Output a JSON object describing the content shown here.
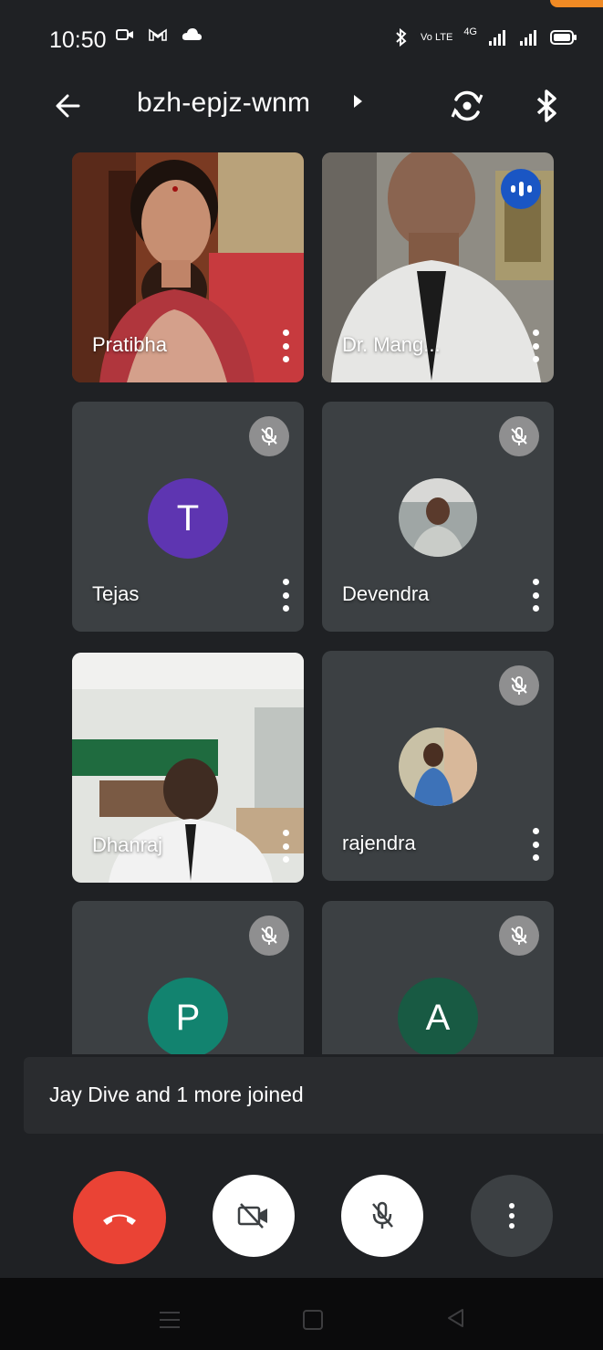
{
  "status_bar": {
    "time": "10:50",
    "left_icons": [
      "screen-record-icon",
      "gmail-icon",
      "cloud-icon"
    ],
    "right_icons": [
      "bluetooth-icon",
      "volte-icon",
      "4g-signal-icon",
      "signal-icon",
      "battery-icon"
    ],
    "volte_label": "Vo LTE",
    "network_label": "4G"
  },
  "header": {
    "back_icon": "arrow-back-icon",
    "meeting_code": "bzh-epjz-wnm",
    "switch_camera_icon": "switch-camera-icon",
    "audio_icon": "bluetooth-icon"
  },
  "participants": [
    {
      "name": "Pratibha",
      "type": "video",
      "muted": false,
      "speaking": false
    },
    {
      "name": "Dr. Mang...",
      "type": "video",
      "muted": false,
      "speaking": true
    },
    {
      "name": "Tejas",
      "type": "letter",
      "initial": "T",
      "avatar_color": "#5e35b1",
      "muted": true
    },
    {
      "name": "Devendra",
      "type": "photo",
      "muted": true
    },
    {
      "name": "Dhanraj",
      "type": "video",
      "muted": false,
      "speaking": false
    },
    {
      "name": "rajendra",
      "type": "photo",
      "muted": true
    },
    {
      "name": "",
      "type": "letter",
      "initial": "P",
      "avatar_color": "#12836f",
      "muted": true
    },
    {
      "name": "",
      "type": "letter",
      "initial": "A",
      "avatar_color": "#185a43",
      "muted": true
    }
  ],
  "toast": {
    "text": "Jay Dive and 1 more joined"
  },
  "controls": {
    "end_call_icon": "phone-hangup-icon",
    "end_call_color": "#ea4335",
    "camera_icon": "video-off-icon",
    "mic_icon": "mic-off-icon",
    "more_icon": "more-vert-icon"
  },
  "nav_bar": {
    "icons": [
      "recents-menu-icon",
      "home-icon",
      "back-triangle-icon"
    ]
  }
}
